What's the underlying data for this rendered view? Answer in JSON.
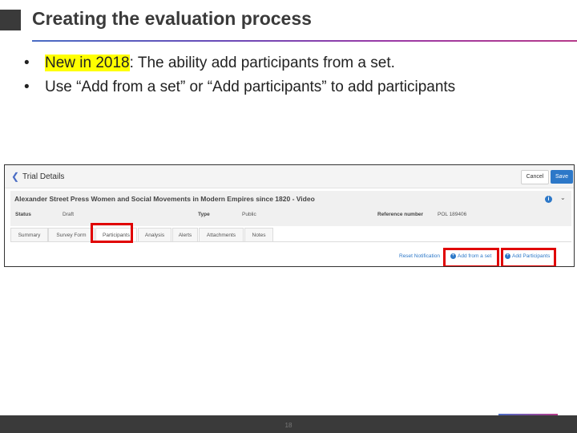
{
  "slide": {
    "title": "Creating the evaluation process",
    "bullets": [
      {
        "highlight": "New in 2018",
        "rest": ": The ability add participants from a set."
      },
      {
        "highlight": "",
        "rest": "Use “Add from a set” or “Add participants” to add participants"
      }
    ],
    "page_number": "18"
  },
  "screenshot": {
    "header_title": "Trial Details",
    "cancel_label": "Cancel",
    "save_label": "Save",
    "record_title": "Alexander Street Press Women and Social Movements in Modern Empires since 1820 - Video",
    "status_label": "Status",
    "status_value": "Draft",
    "type_label": "Type",
    "type_value": "Public",
    "reference_label": "Reference number",
    "reference_value": "POL 189406",
    "tabs": [
      "Summary",
      "Survey Form",
      "Participants",
      "Analysis",
      "Alerts",
      "Attachments",
      "Notes"
    ],
    "reset_label": "Reset Notification",
    "add_from_set_label": "Add from a set",
    "add_participants_label": "Add Participants"
  },
  "colors": {
    "accent_blue": "#2d78c8",
    "highlight_box": "#e00000",
    "text_highlight": "#ffff00"
  }
}
